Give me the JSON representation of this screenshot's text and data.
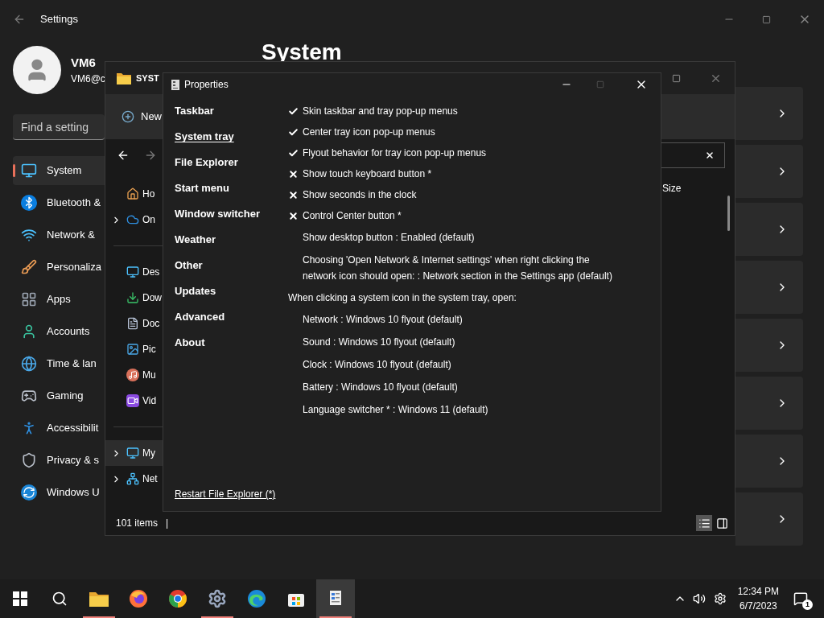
{
  "settings": {
    "title": "Settings",
    "profile": {
      "name": "VM6",
      "email": "VM6@c"
    },
    "search": {
      "placeholder": "Find a setting"
    },
    "heading": "System",
    "nav": [
      {
        "kind": "system",
        "label": "System",
        "selected": true
      },
      {
        "kind": "bluetooth",
        "label": "Bluetooth &",
        "selected": false
      },
      {
        "kind": "network",
        "label": "Network &",
        "selected": false
      },
      {
        "kind": "personalization",
        "label": "Personaliza",
        "selected": false
      },
      {
        "kind": "apps",
        "label": "Apps",
        "selected": false
      },
      {
        "kind": "accounts",
        "label": "Accounts",
        "selected": false
      },
      {
        "kind": "time",
        "label": "Time & lan",
        "selected": false
      },
      {
        "kind": "gaming",
        "label": "Gaming",
        "selected": false
      },
      {
        "kind": "accessibility",
        "label": "Accessibilit",
        "selected": false
      },
      {
        "kind": "privacy",
        "label": "Privacy & s",
        "selected": false
      },
      {
        "kind": "update",
        "label": "Windows U",
        "selected": false
      }
    ],
    "cards": [
      {
        "kind": "link"
      },
      {
        "kind": "link"
      },
      {
        "kind": "link"
      },
      {
        "kind": "link"
      },
      {
        "kind": "link"
      },
      {
        "kind": "link"
      },
      {
        "kind": "link"
      },
      {
        "kind": "link"
      }
    ]
  },
  "explorer": {
    "title": "SYST",
    "new_label": "New",
    "column": "Size",
    "status": "101 items",
    "separator": "|",
    "nav": [
      {
        "kind": "home",
        "label": "Ho",
        "expandable": false,
        "selected": false
      },
      {
        "kind": "cloud",
        "label": "On",
        "expandable": true,
        "selected": false
      },
      {
        "kind": "divider"
      },
      {
        "kind": "desktop",
        "label": "Des",
        "expandable": false,
        "selected": false
      },
      {
        "kind": "downloads",
        "label": "Dow",
        "expandable": false,
        "selected": false
      },
      {
        "kind": "documents",
        "label": "Doc",
        "expandable": false,
        "selected": false
      },
      {
        "kind": "pictures",
        "label": "Pic",
        "expandable": false,
        "selected": false
      },
      {
        "kind": "music",
        "label": "Mu",
        "expandable": false,
        "selected": false
      },
      {
        "kind": "videos",
        "label": "Vid",
        "expandable": false,
        "selected": false
      },
      {
        "kind": "divider"
      },
      {
        "kind": "pc",
        "label": "My",
        "expandable": true,
        "selected": true
      },
      {
        "kind": "net",
        "label": "Net",
        "expandable": true,
        "selected": false
      }
    ],
    "views": [
      {
        "kind": "details",
        "selected": true
      },
      {
        "kind": "preview",
        "selected": false
      }
    ]
  },
  "properties": {
    "title": "Properties",
    "tabs": [
      {
        "label": "Taskbar",
        "selected": false
      },
      {
        "label": "System tray",
        "selected": true
      },
      {
        "label": "File Explorer",
        "selected": false
      },
      {
        "label": "Start menu",
        "selected": false
      },
      {
        "label": "Window switcher",
        "selected": false
      },
      {
        "label": "Weather",
        "selected": false
      },
      {
        "label": "Other",
        "selected": false
      },
      {
        "label": "Updates",
        "selected": false
      },
      {
        "label": "Advanced",
        "selected": false
      },
      {
        "label": "About",
        "selected": false
      }
    ],
    "options": [
      {
        "kind": "check",
        "checked": true,
        "label": "Skin taskbar and tray pop-up menus"
      },
      {
        "kind": "check",
        "checked": true,
        "label": "Center tray icon pop-up menus"
      },
      {
        "kind": "check",
        "checked": true,
        "label": "Flyout behavior for tray icon pop-up menus"
      },
      {
        "kind": "check",
        "checked": false,
        "label": "Show touch keyboard button *"
      },
      {
        "kind": "check",
        "checked": false,
        "label": "Show seconds in the clock"
      },
      {
        "kind": "check",
        "checked": false,
        "label": "Control Center button *"
      },
      {
        "kind": "value",
        "label": "Show desktop button : Enabled (default)"
      },
      {
        "kind": "value",
        "label": "Choosing 'Open Network & Internet settings' when right clicking the network icon should open: : Network section in the Settings app (default)"
      },
      {
        "kind": "heading",
        "label": "When clicking a system icon in the system tray, open:"
      },
      {
        "kind": "value",
        "label": "Network : Windows 10 flyout (default)"
      },
      {
        "kind": "value",
        "label": "Sound : Windows 10 flyout (default)"
      },
      {
        "kind": "value",
        "label": "Clock : Windows 10 flyout (default)"
      },
      {
        "kind": "value",
        "label": "Battery : Windows 10 flyout (default)"
      },
      {
        "kind": "value",
        "label": "Language switcher * : Windows 11 (default)"
      }
    ],
    "link": "Restart File Explorer (*)"
  },
  "taskbar": {
    "apps": [
      {
        "kind": "start",
        "running": false,
        "active": false
      },
      {
        "kind": "search",
        "running": false,
        "active": false
      },
      {
        "kind": "folder",
        "running": true,
        "active": false
      },
      {
        "kind": "firefox",
        "running": false,
        "active": false
      },
      {
        "kind": "chrome",
        "running": false,
        "active": false
      },
      {
        "kind": "settings",
        "running": true,
        "active": false
      },
      {
        "kind": "edge",
        "running": false,
        "active": false
      },
      {
        "kind": "store",
        "running": false,
        "active": false
      },
      {
        "kind": "properties",
        "running": true,
        "active": true
      }
    ],
    "time": "12:34 PM",
    "date": "6/7/2023",
    "notifications": "1"
  }
}
